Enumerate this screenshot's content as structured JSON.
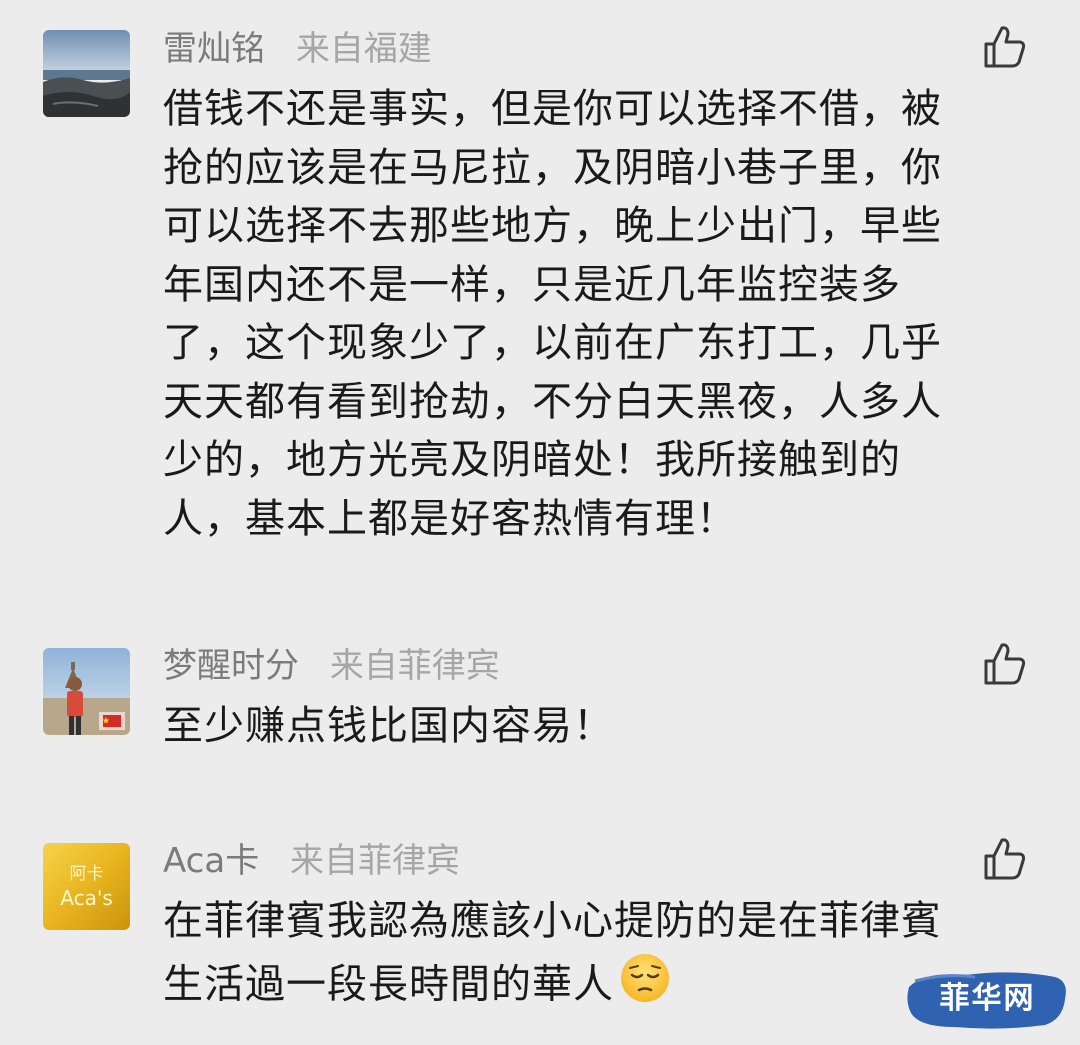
{
  "comments": [
    {
      "author": "雷灿铭",
      "location": "来自福建",
      "lines": [
        "借钱不还是事实，但是你可以选择不借，被",
        "抢的应该是在马尼拉，及阴暗小巷子里，你",
        "可以选择不去那些地方，晚上少出门，早些",
        "年国内还不是一样，只是近几年监控装多",
        "了，这个现象少了，以前在广东打工，几乎",
        "天天都有看到抢劫，不分白天黑夜，人多人",
        "少的，地方光亮及阴暗处！我所接触到的",
        "人，基本上都是好客热情有理！"
      ],
      "avatar_icon": "seaside-landscape-avatar",
      "like_icon": "thumbs-up-icon"
    },
    {
      "author": "梦醒时分",
      "location": "来自菲律宾",
      "lines": [
        "至少赚点钱比国内容易！"
      ],
      "avatar_icon": "person-photo-avatar",
      "like_icon": "thumbs-up-icon"
    },
    {
      "author": "Aca卡",
      "location": "来自菲律宾",
      "avatar_text": "阿卡\nAca's",
      "avatar_text_top": "阿卡",
      "avatar_text_bottom": "Aca's",
      "lines": [
        "在菲律賓我認為應該小心提防的是在菲律賓",
        "生活過一段長時間的華人"
      ],
      "emoji": "pensive-face-emoji",
      "avatar_icon": "gold-text-avatar",
      "like_icon": "thumbs-up-icon"
    }
  ],
  "watermark": {
    "text": "菲华网",
    "color": "#2f62b1"
  },
  "colors": {
    "background": "#ececec",
    "author": "#7b7b7b",
    "location": "#a6a6a6",
    "text": "#1a1a1a"
  }
}
